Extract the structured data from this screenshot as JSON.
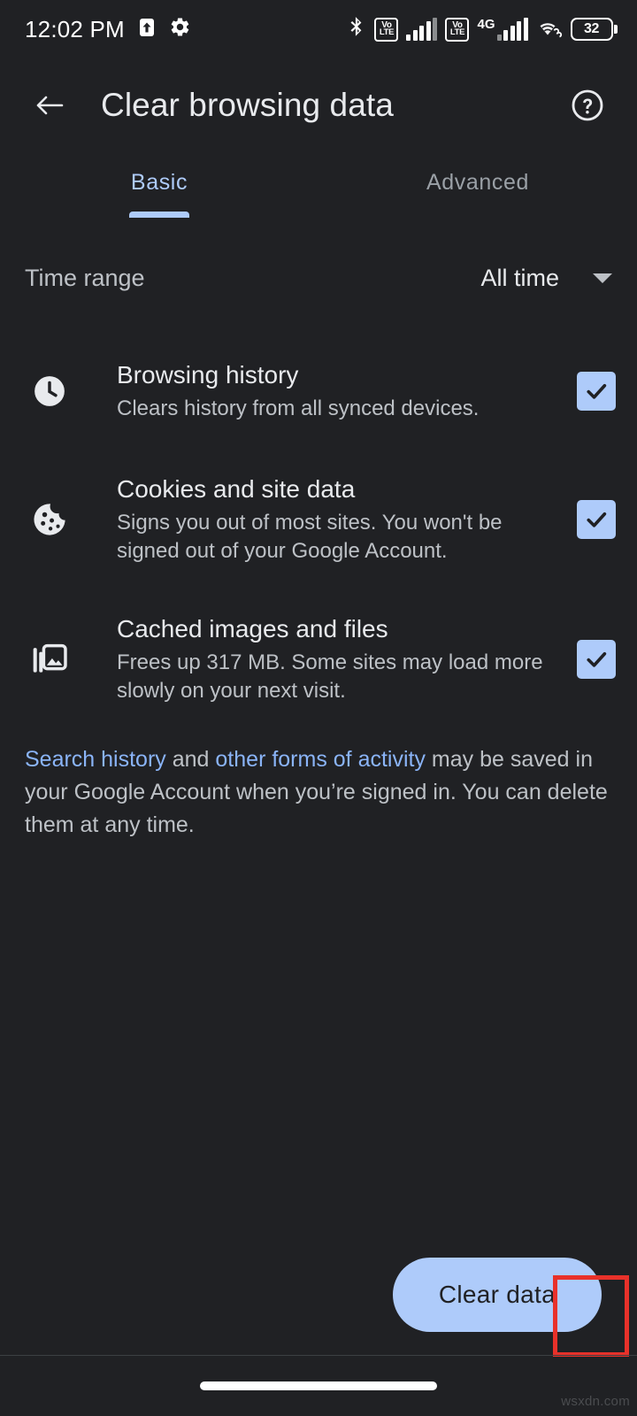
{
  "status_bar": {
    "time": "12:02 PM",
    "upload_icon": "upload-arrow-icon",
    "settings_icon": "gear-icon",
    "bluetooth_icon": "bluetooth-icon",
    "volte_top": "Vo",
    "volte_bottom": "LTE",
    "network_type": "4G",
    "wifi_icon": "wifi-icon",
    "battery_level": "32"
  },
  "app_bar": {
    "back_label": "back-arrow",
    "title": "Clear browsing data",
    "help_label": "help"
  },
  "tabs": [
    {
      "label": "Basic",
      "active": true
    },
    {
      "label": "Advanced",
      "active": false
    }
  ],
  "time_range": {
    "label": "Time range",
    "value": "All time"
  },
  "options": [
    {
      "icon": "clock-icon",
      "title": "Browsing history",
      "subtitle": "Clears history from all synced devices.",
      "checked": true
    },
    {
      "icon": "cookie-icon",
      "title": "Cookies and site data",
      "subtitle": "Signs you out of most sites. You won't be signed out of your Google Account.",
      "checked": true
    },
    {
      "icon": "photo-library-icon",
      "title": "Cached images and files",
      "subtitle": "Frees up 317 MB. Some sites may load more slowly on your next visit.",
      "checked": true
    }
  ],
  "footnote": {
    "link1": "Search history",
    "mid": " and ",
    "link2": "other forms of activity",
    "rest": " may be saved in your Google Account when you’re signed in. You can delete them at any time."
  },
  "bottom": {
    "clear_button": "Clear data"
  },
  "watermark": "wsxdn.com",
  "colors": {
    "background": "#202124",
    "accent": "#aecbfa",
    "link": "#8ab4f8",
    "primary_text": "#e8eaed",
    "secondary_text": "#bdc1c6",
    "inactive_tab": "#9aa0a6",
    "highlight": "#e8312a"
  }
}
